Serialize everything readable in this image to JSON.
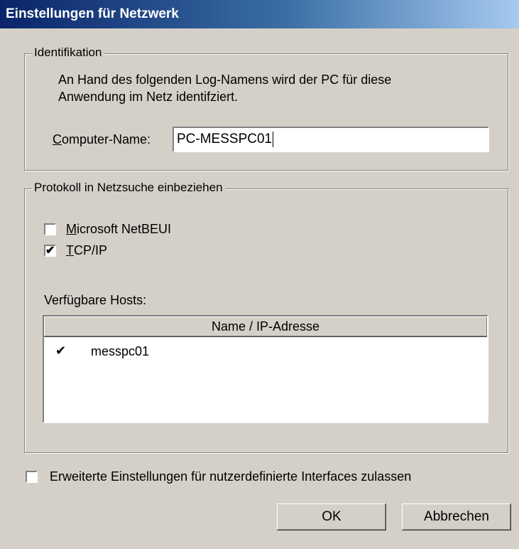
{
  "window": {
    "title": "Einstellungen für Netzwerk"
  },
  "identification": {
    "legend": "Identifikation",
    "description_line1": "An Hand des folgenden Log-Namens wird der PC für diese",
    "description_line2": "Anwendung im Netz identifziert.",
    "computer_name_label_mnemonic": "C",
    "computer_name_label_rest": "omputer-Name:",
    "computer_name_value": "PC-MESSPC01"
  },
  "protocols": {
    "legend": "Protokoll in Netzsuche einbeziehen",
    "netbeui": {
      "mnemonic": "M",
      "rest": "icrosoft NetBEUI",
      "checked": false
    },
    "tcpip": {
      "mnemonic": "T",
      "rest": "CP/IP",
      "checked": true
    },
    "hosts_label": "Verfügbare Hosts:",
    "hosts_column": "Name / IP-Adresse",
    "hosts": [
      {
        "name": "messpc01",
        "checked": true,
        "check_glyph": "✔"
      }
    ]
  },
  "advanced": {
    "label": "Erweiterte Einstellungen für nutzerdefinierte Interfaces zulassen",
    "checked": false
  },
  "buttons": {
    "ok": "OK",
    "cancel": "Abbrechen"
  },
  "check_glyph": "✔"
}
